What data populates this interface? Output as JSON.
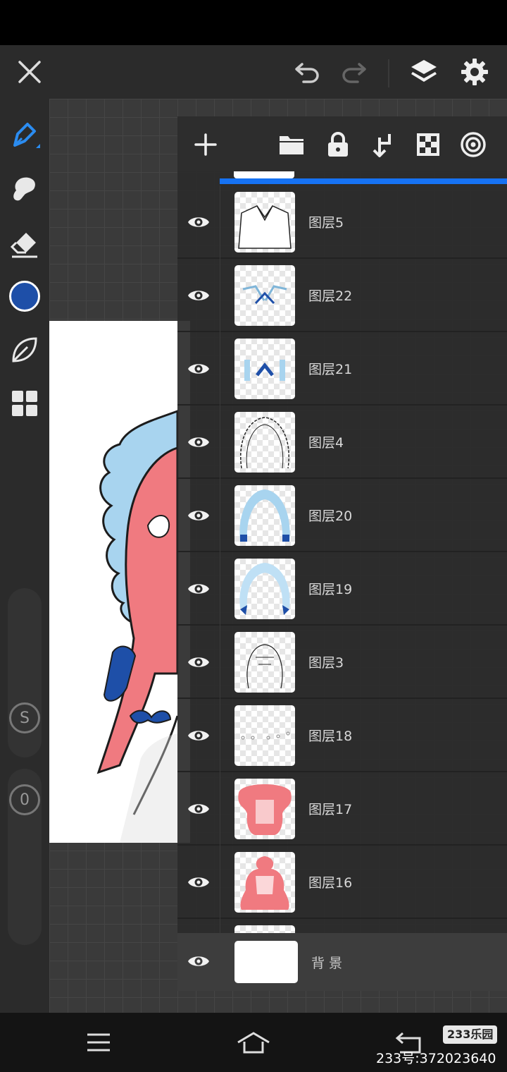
{
  "toolbar": {
    "icons": [
      "close-icon",
      "undo-icon",
      "redo-icon",
      "layers-icon",
      "settings-icon"
    ]
  },
  "left_tools": {
    "icons": [
      "pen-icon",
      "smudge-icon",
      "eraser-icon",
      "color-swatch",
      "leaf-icon",
      "grid-icon"
    ],
    "color": "#1e4fa8",
    "s_label": "S",
    "zero_label": "0"
  },
  "layer_panel": {
    "toolbar_icons": [
      "add-layer-icon",
      "folder-icon",
      "lock-icon",
      "merge-down-icon",
      "transparency-icon",
      "target-icon"
    ],
    "accent": "#1672f3",
    "layers": [
      {
        "name": "图层5"
      },
      {
        "name": "图层22"
      },
      {
        "name": "图层21"
      },
      {
        "name": "图层4"
      },
      {
        "name": "图层20"
      },
      {
        "name": "图层19"
      },
      {
        "name": "图层3"
      },
      {
        "name": "图层18"
      },
      {
        "name": "图层17"
      },
      {
        "name": "图层16"
      }
    ],
    "background_layer": {
      "name": "背景"
    }
  },
  "nav": {
    "icons": [
      "menu-icon",
      "home-icon",
      "back-icon"
    ]
  },
  "watermark": {
    "badge": "233乐园",
    "text": "233号:372023640"
  }
}
